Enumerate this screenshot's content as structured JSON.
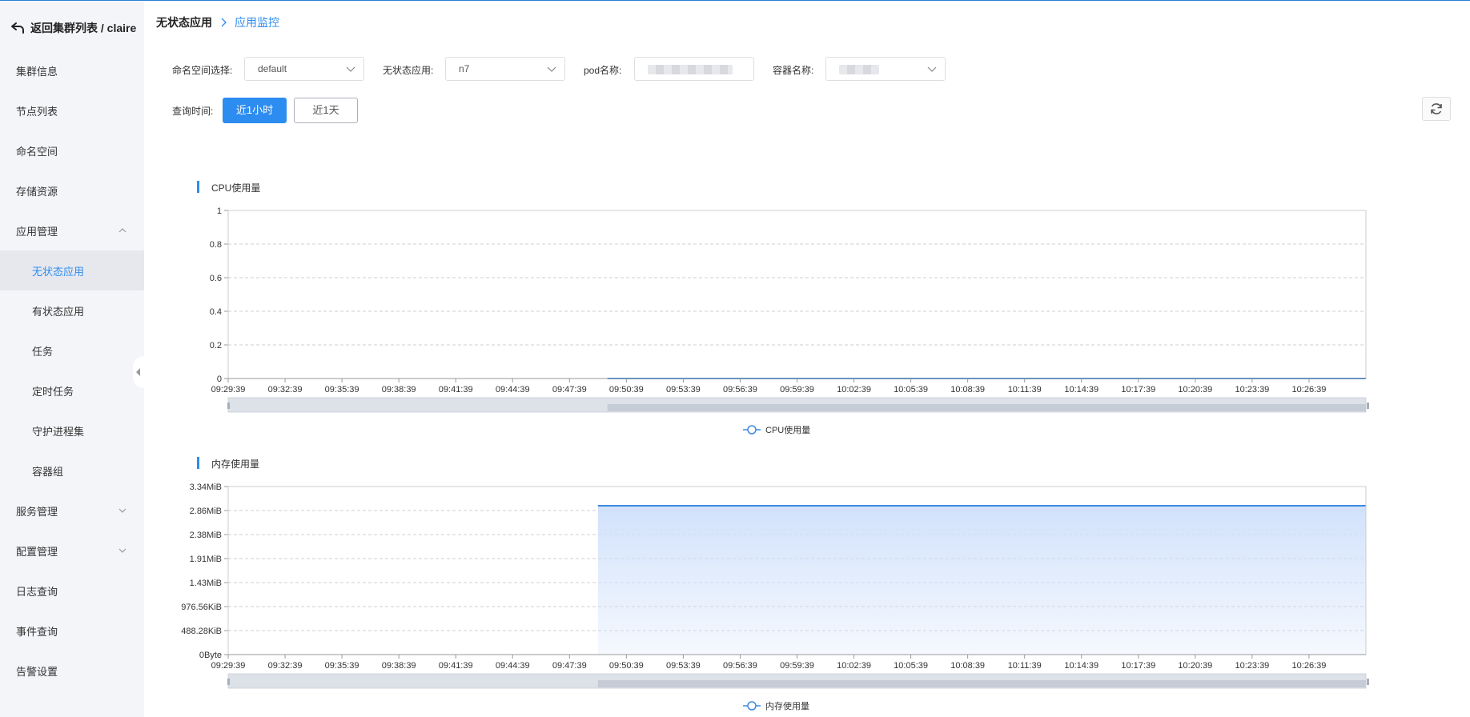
{
  "sidebar": {
    "back_label": "返回集群列表 / claire",
    "items": [
      {
        "label": "集群信息"
      },
      {
        "label": "节点列表"
      },
      {
        "label": "命名空间"
      },
      {
        "label": "存储资源"
      },
      {
        "label": "应用管理"
      },
      {
        "label": "无状态应用"
      },
      {
        "label": "有状态应用"
      },
      {
        "label": "任务"
      },
      {
        "label": "定时任务"
      },
      {
        "label": "守护进程集"
      },
      {
        "label": "容器组"
      },
      {
        "label": "服务管理"
      },
      {
        "label": "配置管理"
      },
      {
        "label": "日志查询"
      },
      {
        "label": "事件查询"
      },
      {
        "label": "告警设置"
      }
    ]
  },
  "breadcrumb": {
    "current": "无状态应用",
    "link": "应用监控"
  },
  "filters": {
    "namespace_label": "命名空间选择:",
    "namespace_value": "default",
    "app_label": "无状态应用:",
    "app_value": "n7",
    "pod_label": "pod名称:",
    "container_label": "容器名称:",
    "time_label": "查询时间:",
    "time_1h": "近1小时",
    "time_1d": "近1天"
  },
  "colors": {
    "accent": "#2d8cf0",
    "line": "#3f8ae0",
    "area": "#cfe0fb"
  },
  "chart_data": [
    {
      "type": "line",
      "title": "CPU使用量",
      "legend": "CPU使用量",
      "x_labels": [
        "09:29:39",
        "09:32:39",
        "09:35:39",
        "09:38:39",
        "09:41:39",
        "09:44:39",
        "09:47:39",
        "09:50:39",
        "09:53:39",
        "09:56:39",
        "09:59:39",
        "10:02:39",
        "10:05:39",
        "10:08:39",
        "10:11:39",
        "10:14:39",
        "10:17:39",
        "10:20:39",
        "10:23:39",
        "10:26:39"
      ],
      "y_ticks": [
        "0",
        "0.2",
        "0.4",
        "0.6",
        "0.8",
        "1"
      ],
      "ylim": [
        0,
        1
      ],
      "series": [
        {
          "name": "CPU使用量",
          "points": [
            [
              "09:49:39",
              0
            ],
            [
              "10:29:39",
              0
            ]
          ]
        }
      ],
      "grid": true,
      "legend_position": "bottom"
    },
    {
      "type": "area",
      "title": "内存使用量",
      "legend": "内存使用量",
      "x_labels": [
        "09:29:39",
        "09:32:39",
        "09:35:39",
        "09:38:39",
        "09:41:39",
        "09:44:39",
        "09:47:39",
        "09:50:39",
        "09:53:39",
        "09:56:39",
        "09:59:39",
        "10:02:39",
        "10:05:39",
        "10:08:39",
        "10:11:39",
        "10:14:39",
        "10:17:39",
        "10:20:39",
        "10:23:39",
        "10:26:39"
      ],
      "y_ticks": [
        "0Byte",
        "488.28KiB",
        "976.56KiB",
        "1.43MiB",
        "1.91MiB",
        "2.38MiB",
        "2.86MiB",
        "3.34MiB"
      ],
      "ylim": [
        0,
        7
      ],
      "series": [
        {
          "name": "内存使用量",
          "points": [
            [
              "09:49:09",
              6.2
            ],
            [
              "10:29:39",
              6.2
            ]
          ]
        }
      ],
      "grid": true,
      "legend_position": "bottom"
    }
  ]
}
